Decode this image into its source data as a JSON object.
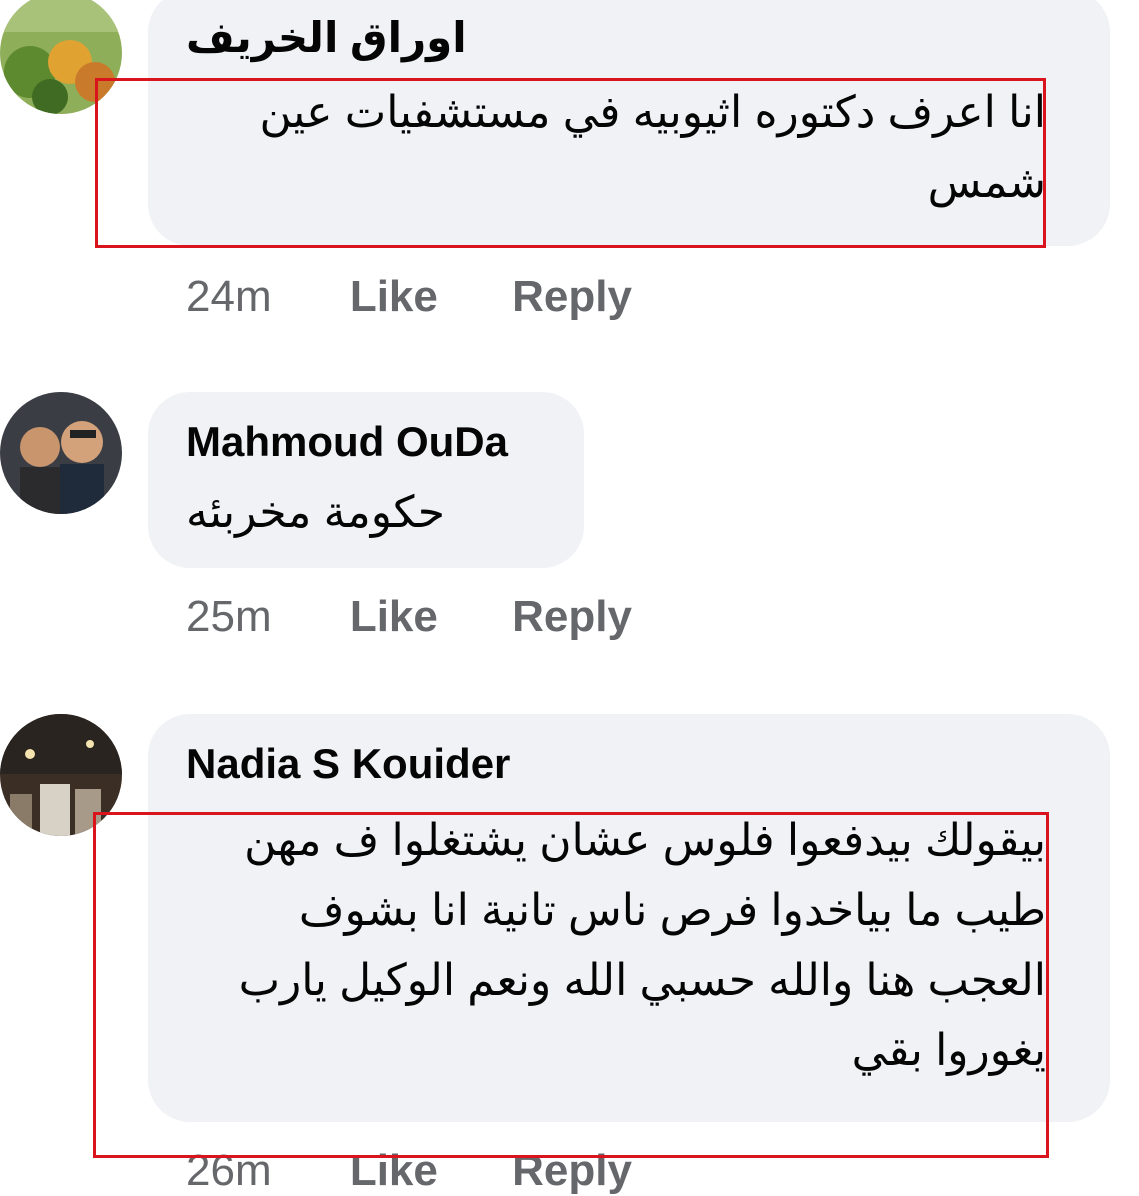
{
  "comments": [
    {
      "author": "اوراق الخريف",
      "text": "انا اعرف دكتوره اثيوبيه في مستشفيات عين شمس",
      "time": "24m",
      "like_label": "Like",
      "reply_label": "Reply"
    },
    {
      "author": "Mahmoud OuDa",
      "text": "حكومة مخربئه",
      "time": "25m",
      "like_label": "Like",
      "reply_label": "Reply"
    },
    {
      "author": "Nadia S Kouider",
      "text": "بيقولك بيدفعوا فلوس عشان يشتغلوا ف مهن طيب ما بياخدوا فرص ناس تانية انا بشوف العجب هنا والله حسبي الله ونعم الوكيل يارب يغوروا بقي",
      "time": "26m",
      "like_label": "Like",
      "reply_label": "Reply"
    }
  ],
  "colors": {
    "bubble": "#f0f2f5",
    "text": "#050505",
    "meta": "#65676b",
    "highlight_border": "#d9141c"
  }
}
